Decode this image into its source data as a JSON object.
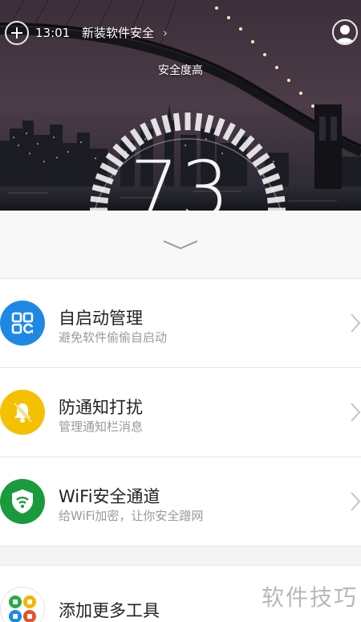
{
  "header": {
    "time": "13:01",
    "message": "新装软件安全",
    "message_chevron": "›",
    "security_label": "安全度高",
    "score": "73"
  },
  "icons": {
    "add": "plus-circle-icon",
    "avatar": "user-avatar-icon",
    "collapse": "chevron-down-icon"
  },
  "colors": {
    "autostart": "#1e88e5",
    "notify": "#f5c000",
    "wifi": "#1a9a3c"
  },
  "list": [
    {
      "title": "自启动管理",
      "subtitle": "避免软件偷偷自启动",
      "icon": "autostart-grid-icon"
    },
    {
      "title": "防通知打扰",
      "subtitle": "管理通知栏消息",
      "icon": "bell-mute-icon"
    },
    {
      "title": "WiFi安全通道",
      "subtitle": "给WiFi加密，让你安全蹭网",
      "icon": "wifi-shield-icon"
    }
  ],
  "more_tools": {
    "title": "添加更多工具",
    "icon": "tools-cluster-icon"
  },
  "watermark": "软件技巧"
}
